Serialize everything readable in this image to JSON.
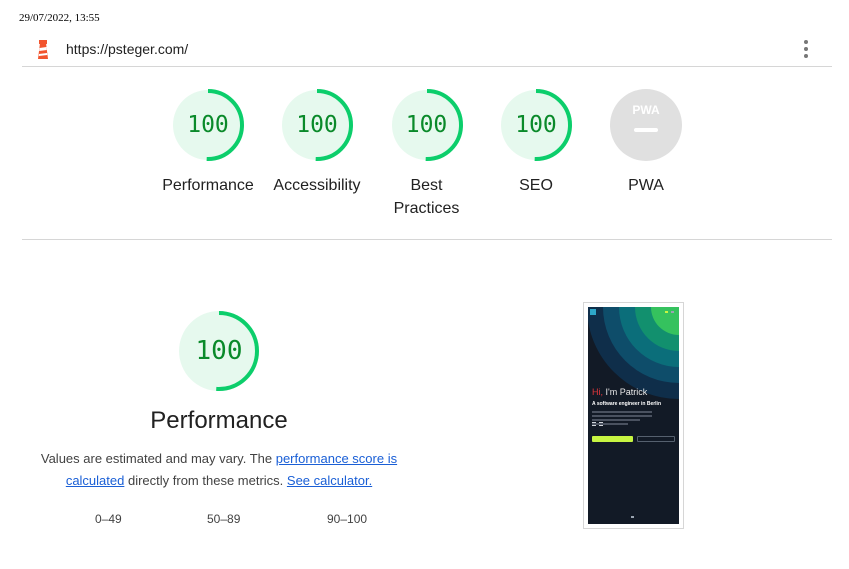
{
  "timestamp": "29/07/2022, 13:55",
  "url": "https://psteger.com/",
  "colors": {
    "pass": "#0cce6b",
    "pass_bg": "#e6f9ee",
    "pass_text": "#0a8a2a",
    "fail": "#eb3b2f",
    "na": "#e0e0e0"
  },
  "categories": [
    {
      "score": "100",
      "label": "Performance"
    },
    {
      "score": "100",
      "label": "Accessibility"
    },
    {
      "score": "100",
      "label": "Best Practices"
    },
    {
      "score": "100",
      "label": "SEO"
    },
    {
      "badge": "PWA",
      "label": "PWA"
    }
  ],
  "performance": {
    "score": "100",
    "title": "Performance",
    "desc_prefix": "Values are estimated and may vary. The ",
    "link_score": "performance score is calculated",
    "desc_middle": " directly from these metrics. ",
    "link_calc": "See calculator.",
    "legend": {
      "fail": "0–49",
      "average": "50–89",
      "pass": "90–100"
    }
  },
  "screenshot": {
    "hi": "Hi,",
    "name": " I'm Patrick",
    "tagline": "A software engineer in Berlin"
  }
}
